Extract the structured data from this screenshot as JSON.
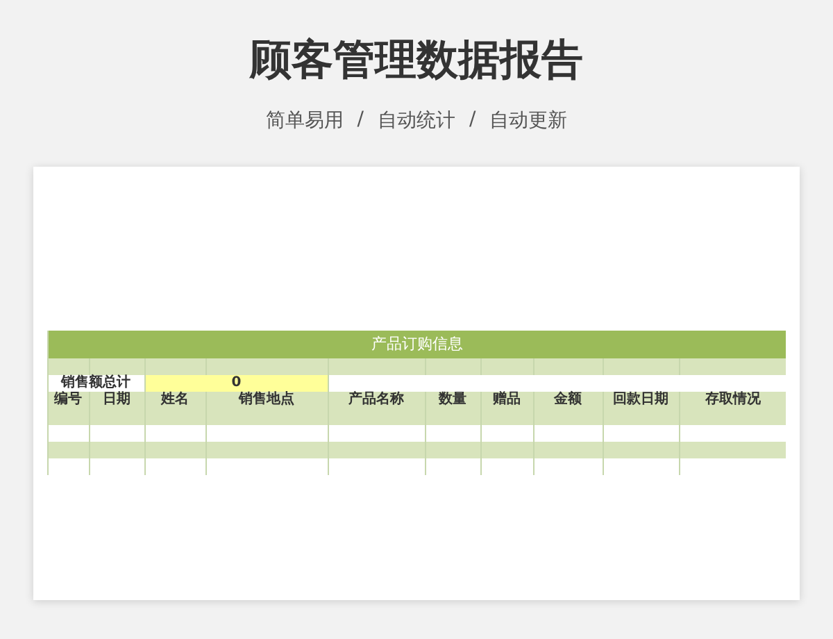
{
  "title": "顾客管理数据报告",
  "features": [
    "简单易用",
    "自动统计",
    "自动更新"
  ],
  "separator": "/",
  "sheet": {
    "title": "产品订购信息",
    "summary": {
      "label": "销售额总计",
      "value": "0"
    },
    "columns": [
      "编号",
      "日期",
      "姓名",
      "销售地点",
      "产品名称",
      "数量",
      "赠品",
      "金额",
      "回款日期",
      "存取情况"
    ]
  }
}
